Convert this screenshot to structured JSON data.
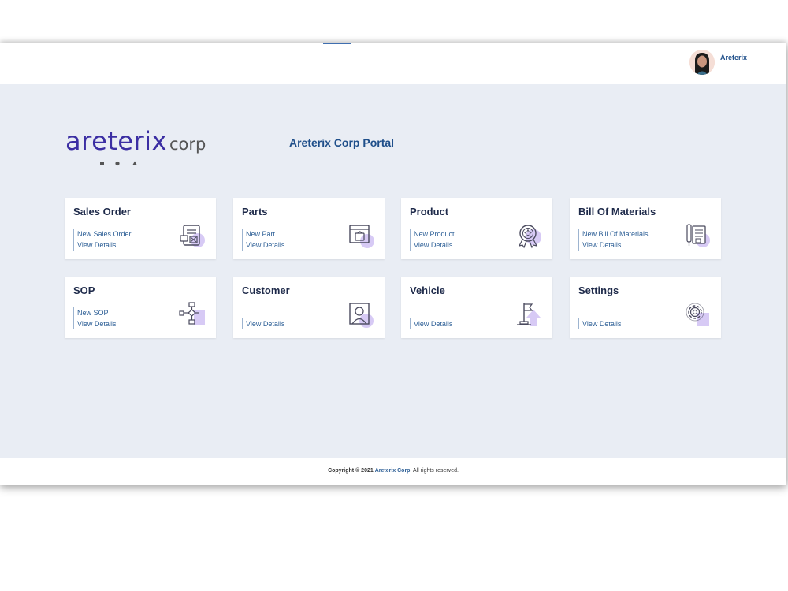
{
  "header": {
    "username": "Areterix"
  },
  "logo": {
    "word": "areterix",
    "suffix": "corp"
  },
  "portal_title": "Areterix Corp Portal",
  "cards": [
    {
      "title": "Sales Order",
      "links": [
        "New Sales Order",
        "View Details"
      ],
      "icon": "document-form-icon"
    },
    {
      "title": "Parts",
      "links": [
        "New Part",
        "View Details"
      ],
      "icon": "shopping-bag-window-icon"
    },
    {
      "title": "Product",
      "links": [
        "New Product",
        "View Details"
      ],
      "icon": "award-badge-icon"
    },
    {
      "title": "Bill Of Materials",
      "links": [
        "New Bill Of Materials",
        "View Details"
      ],
      "icon": "clipboard-documents-icon"
    },
    {
      "title": "SOP",
      "links": [
        "New SOP",
        "View Details"
      ],
      "icon": "flowchart-icon"
    },
    {
      "title": "Customer",
      "links": [
        "View Details"
      ],
      "icon": "customer-portrait-icon"
    },
    {
      "title": "Vehicle",
      "links": [
        "View Details"
      ],
      "icon": "flag-arrow-icon"
    },
    {
      "title": "Settings",
      "links": [
        "View Details"
      ],
      "icon": "gear-icon"
    }
  ],
  "footer": {
    "copyright": "Copyright © 2021",
    "brand": "Areterix Corp.",
    "rights": "All rights reserved."
  },
  "colors": {
    "background": "#e9edf4",
    "accent": "#1f4f8a",
    "logo": "#3b2ea3",
    "icon_tint": "#c8b6f0"
  }
}
